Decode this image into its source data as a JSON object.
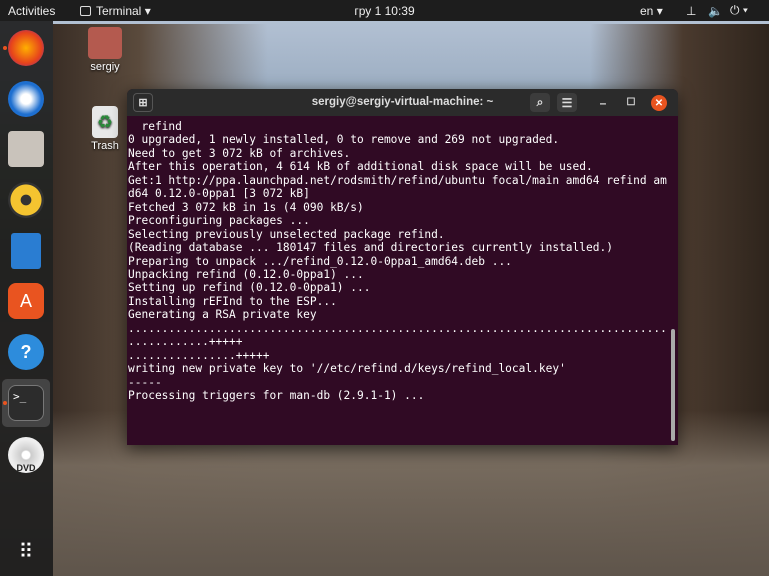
{
  "topbar": {
    "activities": "Activities",
    "app_menu": "Terminal",
    "clock": "гру 1  10:39",
    "lang": "en"
  },
  "desktop": {
    "home": "sergiy",
    "trash": "Trash"
  },
  "dock": [
    "firefox-icon",
    "thunderbird-icon",
    "files-icon",
    "rhythmbox-icon",
    "libreoffice-writer-icon",
    "software-center-icon",
    "help-icon",
    "terminal-icon",
    "dvd-icon",
    "show-apps-icon"
  ],
  "terminal": {
    "title": "sergiy@sergiy-virtual-machine: ~",
    "lines": [
      "  refind",
      "0 upgraded, 1 newly installed, 0 to remove and 269 not upgraded.",
      "Need to get 3 072 kB of archives.",
      "After this operation, 4 614 kB of additional disk space will be used.",
      "Get:1 http://ppa.launchpad.net/rodsmith/refind/ubuntu focal/main amd64 refind am",
      "d64 0.12.0-0ppa1 [3 072 kB]",
      "Fetched 3 072 kB in 1s (4 090 kB/s)",
      "Preconfiguring packages ...",
      "Selecting previously unselected package refind.",
      "(Reading database ... 180147 files and directories currently installed.)",
      "Preparing to unpack .../refind_0.12.0-0ppa1_amd64.deb ...",
      "Unpacking refind (0.12.0-0ppa1) ...",
      "Setting up refind (0.12.0-0ppa1) ...",
      "Installing rEFInd to the ESP...",
      "Generating a RSA private key",
      "................................................................................",
      "............+++++",
      "................+++++",
      "writing new private key to '//etc/refind.d/keys/refind_local.key'",
      "-----",
      "Processing triggers for man-db (2.9.1-1) ..."
    ]
  }
}
